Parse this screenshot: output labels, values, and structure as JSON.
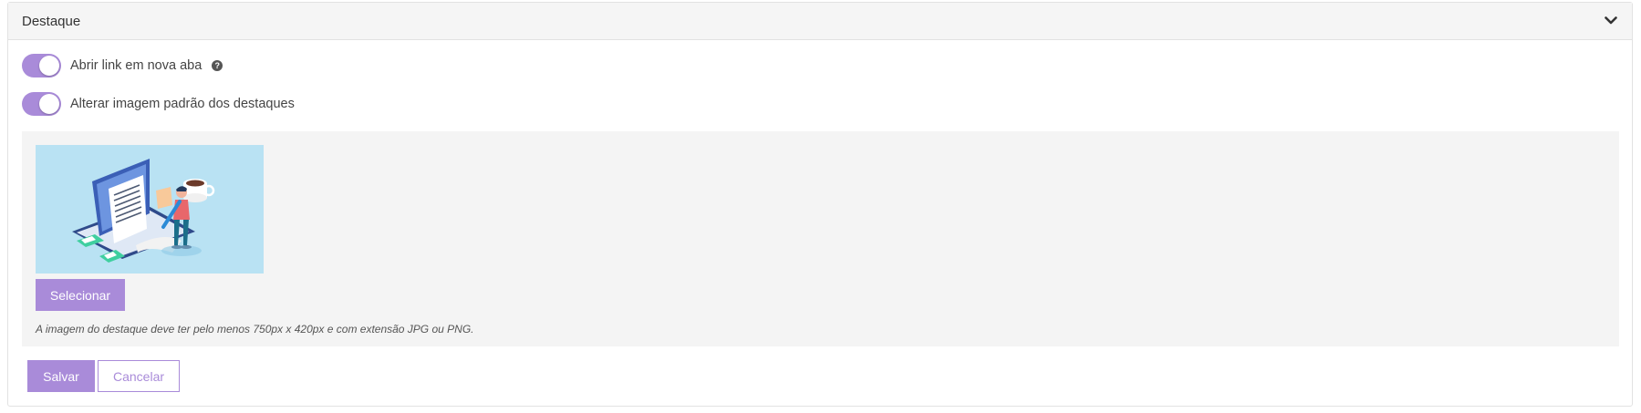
{
  "panel": {
    "title": "Destaque",
    "collapse_icon": "chevron-down-icon"
  },
  "toggles": [
    {
      "label": "Abrir link em nova aba",
      "checked": true,
      "help_icon": "question-circle-icon"
    },
    {
      "label": "Alterar imagem padrão dos destaques",
      "checked": true
    }
  ],
  "image_section": {
    "preview_image": "laptop-writer-illustration",
    "select_label": "Selecionar",
    "hint": "A imagem do destaque deve ter pelo menos 750px x 420px e com extensão JPG ou PNG."
  },
  "actions": {
    "save_label": "Salvar",
    "cancel_label": "Cancelar"
  },
  "colors": {
    "accent": "#a98bd9",
    "header_bg": "#f5f5f5",
    "image_box_bg": "#f4f4f4",
    "preview_bg": "#b9e2f3"
  }
}
